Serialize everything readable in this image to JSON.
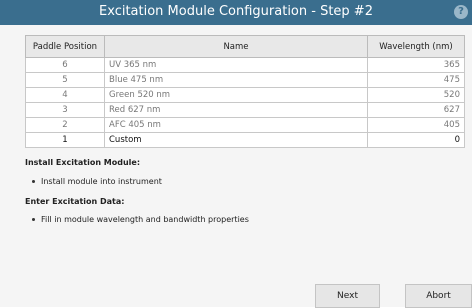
{
  "window": {
    "title": "Excitation Module Configuration - Step #2",
    "help_label": "?"
  },
  "table": {
    "headers": {
      "position": "Paddle Position",
      "name": "Name",
      "wavelength": "Wavelength (nm)"
    },
    "rows": [
      {
        "position": "6",
        "name": "UV 365 nm",
        "wavelength": "365"
      },
      {
        "position": "5",
        "name": "Blue 475 nm",
        "wavelength": "475"
      },
      {
        "position": "4",
        "name": "Green 520 nm",
        "wavelength": "520"
      },
      {
        "position": "3",
        "name": "Red 627 nm",
        "wavelength": "627"
      },
      {
        "position": "2",
        "name": "AFC 405 nm",
        "wavelength": "405"
      },
      {
        "position": "1",
        "name": "Custom",
        "wavelength": "0"
      }
    ]
  },
  "install": {
    "heading": "Install Excitation Module:",
    "bullet": "Install module into instrument"
  },
  "enter": {
    "heading": "Enter Excitation Data:",
    "bullet": "Fill in module wavelength and bandwidth properties"
  },
  "buttons": {
    "next": "Next",
    "abort": "Abort"
  },
  "colors": {
    "title_bar": "#3a6e8e",
    "background": "#f5f5f5",
    "button": "#e6e6e6"
  }
}
